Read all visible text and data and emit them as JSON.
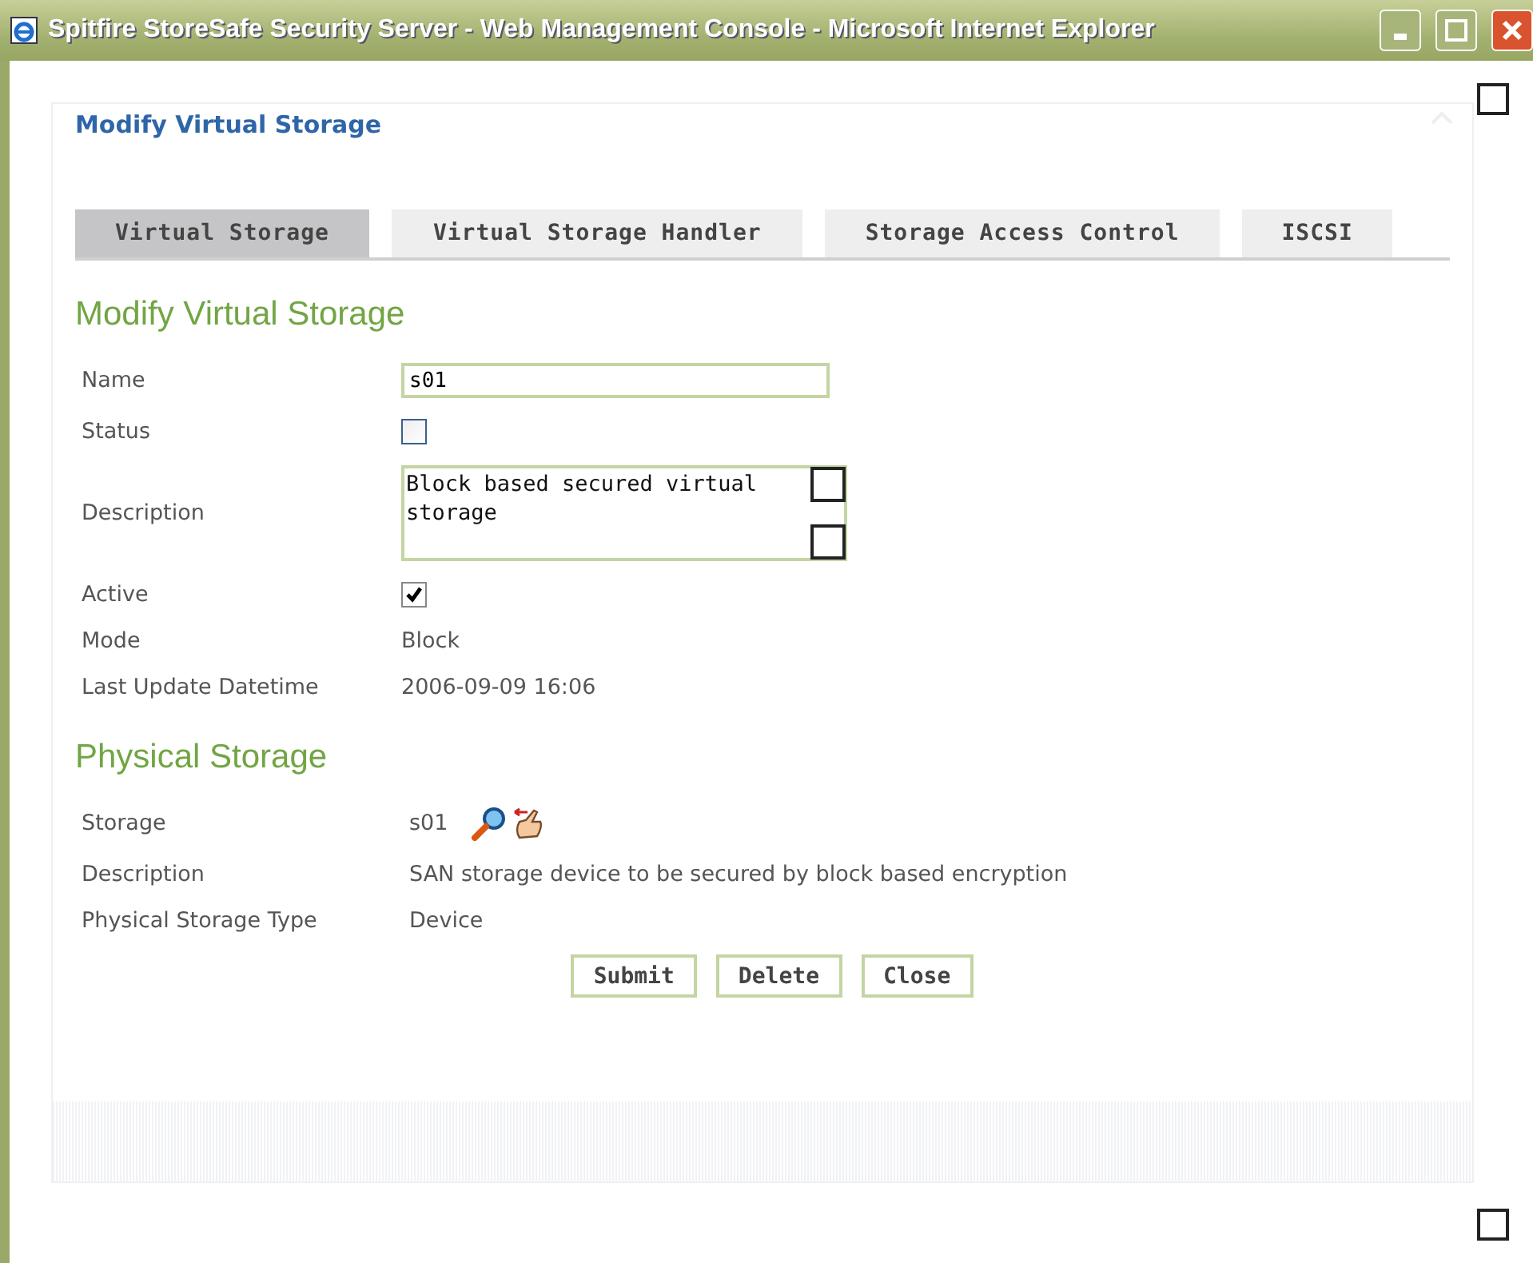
{
  "window": {
    "title": "Spitfire StoreSafe Security Server - Web Management Console - Microsoft Internet Explorer"
  },
  "panel": {
    "title": "Modify Virtual Storage"
  },
  "tabs": [
    {
      "label": "Virtual Storage",
      "selected": true
    },
    {
      "label": "Virtual Storage Handler",
      "selected": false
    },
    {
      "label": "Storage Access Control",
      "selected": false
    },
    {
      "label": "ISCSI",
      "selected": false
    }
  ],
  "virtual_storage": {
    "heading": "Modify Virtual Storage",
    "fields": [
      {
        "kind": "input",
        "label": "Name",
        "value": "s01"
      },
      {
        "kind": "checkbox",
        "label": "Status",
        "checked": false
      },
      {
        "kind": "textarea",
        "label": "Description",
        "value": "Block based secured virtual storage"
      },
      {
        "kind": "checkbox",
        "label": "Active",
        "checked": true
      },
      {
        "kind": "text",
        "label": "Mode",
        "value": "Block"
      },
      {
        "kind": "text",
        "label": "Last Update Datetime",
        "value": "2006-09-09 16:06"
      }
    ]
  },
  "physical_storage": {
    "heading": "Physical Storage",
    "fields": [
      {
        "kind": "storage",
        "label": "Storage",
        "value": "s01"
      },
      {
        "kind": "text",
        "label": "Description",
        "value": "SAN storage device to be secured by block based encryption"
      },
      {
        "kind": "text",
        "label": "Physical Storage Type",
        "value": "Device"
      }
    ]
  },
  "buttons": [
    "Submit",
    "Delete",
    "Close"
  ]
}
